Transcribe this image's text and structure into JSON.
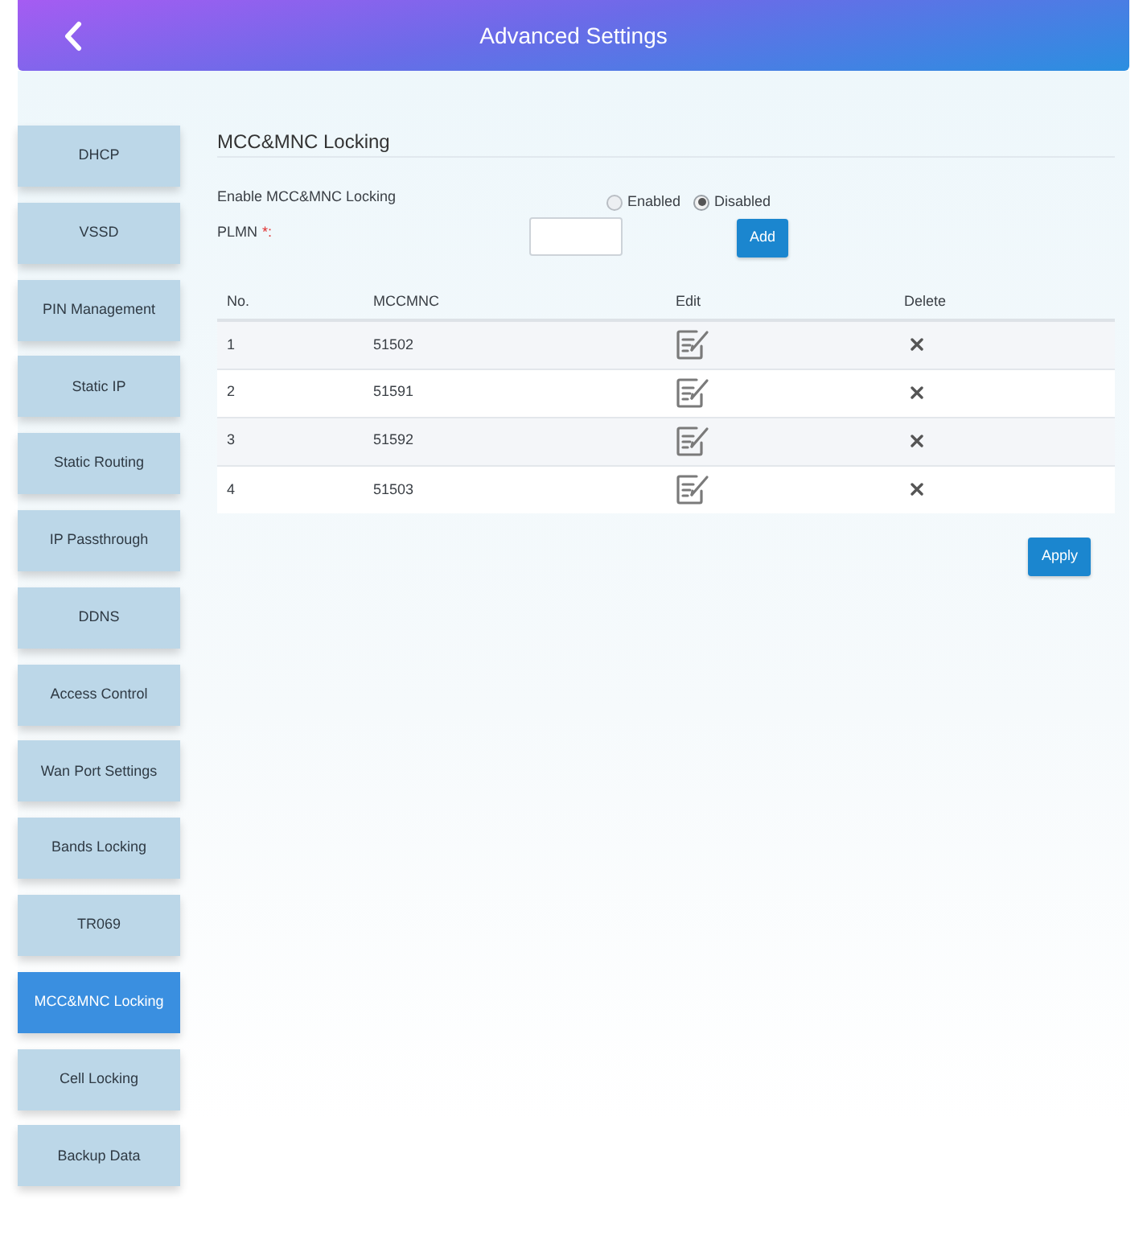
{
  "header": {
    "title": "Advanced Settings"
  },
  "sidebar": {
    "items": [
      {
        "label": "DHCP",
        "selected": false
      },
      {
        "label": "VSSD",
        "selected": false
      },
      {
        "label": "PIN Management",
        "selected": false
      },
      {
        "label": "Static IP",
        "selected": false
      },
      {
        "label": "Static Routing",
        "selected": false
      },
      {
        "label": "IP Passthrough",
        "selected": false
      },
      {
        "label": "DDNS",
        "selected": false
      },
      {
        "label": "Access Control",
        "selected": false
      },
      {
        "label": "Wan Port Settings",
        "selected": false
      },
      {
        "label": "Bands Locking",
        "selected": false
      },
      {
        "label": "TR069",
        "selected": false
      },
      {
        "label": "MCC&MNC Locking",
        "selected": true
      },
      {
        "label": "Cell Locking",
        "selected": false
      },
      {
        "label": "Backup Data",
        "selected": false
      }
    ]
  },
  "section": {
    "title": "MCC&MNC Locking",
    "enable": {
      "label": "Enable MCC&MNC Locking",
      "options": [
        {
          "label": "Enabled",
          "selected": false
        },
        {
          "label": "Disabled",
          "selected": true
        }
      ]
    },
    "plmn": {
      "label": "PLMN",
      "required_mark": "*:",
      "add_button": "Add"
    },
    "table": {
      "columns": [
        "No.",
        "MCCMNC",
        "Edit",
        "Delete"
      ],
      "rows": [
        {
          "no": "1",
          "mccmnc": "51502"
        },
        {
          "no": "2",
          "mccmnc": "51591"
        },
        {
          "no": "3",
          "mccmnc": "51592"
        },
        {
          "no": "4",
          "mccmnc": "51503"
        }
      ]
    },
    "apply_button": "Apply"
  }
}
